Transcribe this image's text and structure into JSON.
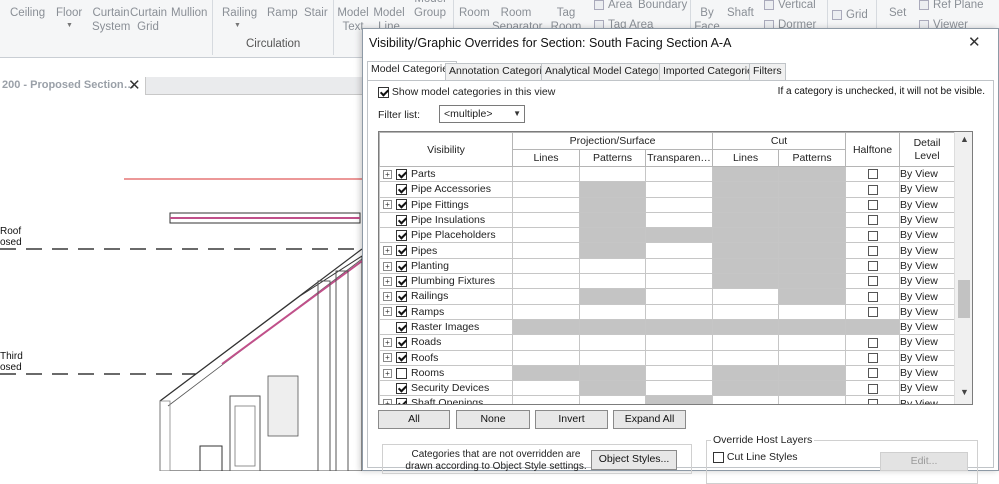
{
  "ribbon": {
    "buttons": [
      "Ceiling",
      "Floor",
      "Curtain System",
      "Curtain Grid",
      "Mullion",
      "Railing",
      "Ramp",
      "Stair",
      "Model Text",
      "Model Line",
      "Model Group",
      "Room",
      "Room Separator",
      "Tag Room",
      "Area",
      "Boundary",
      "Tag Area",
      "By Face",
      "Shaft",
      "Vertical",
      "Dormer",
      "Grid",
      "Set",
      "Ref Plane",
      "Viewer"
    ],
    "group_label": "Circulation"
  },
  "view_tab": {
    "label": "200 - Proposed Section…",
    "close": "✕"
  },
  "levels": [
    {
      "line1": "Roof",
      "line2": "osed"
    },
    {
      "line1": "Third",
      "line2": "osed"
    }
  ],
  "dialog": {
    "title": "Visibility/Graphic Overrides for Section: South Facing Section A-A",
    "close": "✕",
    "tabs": [
      "Model Categories",
      "Annotation Categories",
      "Analytical Model Categories",
      "Imported Categories",
      "Filters"
    ],
    "show_model_label": "Show model categories in this view",
    "hint": "If a category is unchecked, it will not be visible.",
    "filter_label": "Filter list:",
    "filter_value": "<multiple>",
    "columns": {
      "visibility": "Visibility",
      "projection": "Projection/Surface",
      "cut": "Cut",
      "halftone": "Halftone",
      "detail_level": "Detail Level",
      "lines": "Lines",
      "patterns": "Patterns",
      "transparency": "Transparen…",
      "cut_lines": "Lines",
      "cut_patterns": "Patterns"
    },
    "rows": [
      {
        "name": "Parts",
        "expand": true,
        "checked": true,
        "gray": [
          false,
          false,
          false,
          true,
          true
        ],
        "halftone": true,
        "detail": "By View"
      },
      {
        "name": "Pipe Accessories",
        "expand": false,
        "checked": true,
        "gray": [
          false,
          true,
          false,
          true,
          true
        ],
        "halftone": true,
        "detail": "By View"
      },
      {
        "name": "Pipe Fittings",
        "expand": true,
        "checked": true,
        "gray": [
          false,
          true,
          false,
          true,
          true
        ],
        "halftone": true,
        "detail": "By View"
      },
      {
        "name": "Pipe Insulations",
        "expand": false,
        "checked": true,
        "gray": [
          false,
          true,
          false,
          true,
          true
        ],
        "halftone": true,
        "detail": "By View"
      },
      {
        "name": "Pipe Placeholders",
        "expand": false,
        "checked": true,
        "gray": [
          false,
          true,
          true,
          true,
          true
        ],
        "halftone": true,
        "detail": "By View"
      },
      {
        "name": "Pipes",
        "expand": true,
        "checked": true,
        "gray": [
          false,
          true,
          false,
          true,
          true
        ],
        "halftone": true,
        "detail": "By View"
      },
      {
        "name": "Planting",
        "expand": true,
        "checked": true,
        "gray": [
          false,
          false,
          false,
          true,
          true
        ],
        "halftone": true,
        "detail": "By View"
      },
      {
        "name": "Plumbing Fixtures",
        "expand": true,
        "checked": true,
        "gray": [
          false,
          false,
          false,
          true,
          true
        ],
        "halftone": true,
        "detail": "By View"
      },
      {
        "name": "Railings",
        "expand": true,
        "checked": true,
        "gray": [
          false,
          true,
          false,
          false,
          true
        ],
        "halftone": true,
        "detail": "By View"
      },
      {
        "name": "Ramps",
        "expand": true,
        "checked": true,
        "gray": [
          false,
          false,
          false,
          false,
          false
        ],
        "halftone": true,
        "detail": "By View"
      },
      {
        "name": "Raster Images",
        "expand": false,
        "checked": true,
        "gray": [
          true,
          true,
          true,
          true,
          true
        ],
        "halftone": false,
        "detail": "By View"
      },
      {
        "name": "Roads",
        "expand": true,
        "checked": true,
        "gray": [
          false,
          false,
          false,
          false,
          false
        ],
        "halftone": true,
        "detail": "By View"
      },
      {
        "name": "Roofs",
        "expand": true,
        "checked": true,
        "gray": [
          false,
          false,
          false,
          false,
          false
        ],
        "halftone": true,
        "detail": "By View"
      },
      {
        "name": "Rooms",
        "expand": true,
        "checked": false,
        "gray": [
          true,
          true,
          false,
          true,
          true
        ],
        "halftone": true,
        "detail": "By View"
      },
      {
        "name": "Security Devices",
        "expand": false,
        "checked": true,
        "gray": [
          false,
          true,
          false,
          true,
          true
        ],
        "halftone": true,
        "detail": "By View"
      },
      {
        "name": "Shaft Openings",
        "expand": true,
        "checked": true,
        "gray": [
          false,
          false,
          true,
          false,
          false
        ],
        "halftone": true,
        "detail": "By View"
      }
    ],
    "buttons": {
      "all": "All",
      "none": "None",
      "invert": "Invert",
      "expand_all": "Expand All",
      "object_styles": "Object Styles...",
      "edit": "Edit..."
    },
    "override_host_label": "Override Host Layers",
    "cut_line_styles": "Cut Line Styles",
    "note": "Categories that are not overridden are drawn according to Object Style settings."
  }
}
